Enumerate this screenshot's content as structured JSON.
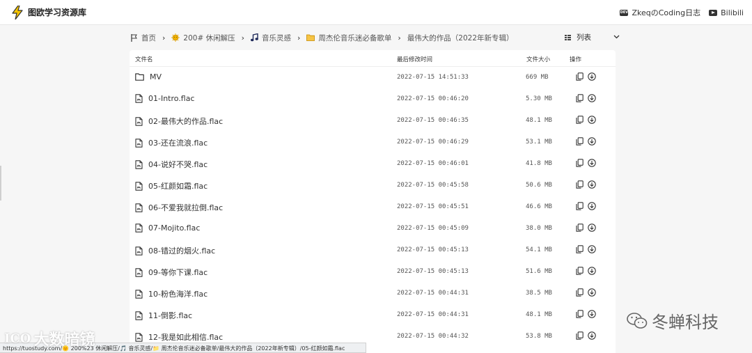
{
  "header": {
    "title": "图欧学习资源库",
    "links": [
      {
        "icon": "dev-icon",
        "badge": "DEV",
        "label": "ZkeqのCoding日志"
      },
      {
        "icon": "youtube-icon",
        "label": "Bilibili"
      }
    ]
  },
  "breadcrumb": {
    "items": [
      {
        "label": "首页",
        "icon": "home-flag-icon"
      },
      {
        "label": "200# 休闲解压",
        "icon": "sun-face-icon"
      },
      {
        "label": "音乐灵感",
        "icon": "music-note-icon"
      },
      {
        "label": "周杰伦音乐迷必备歌单",
        "icon": "folder-icon"
      },
      {
        "label": "最伟大的作品（2022年新专辑）",
        "icon": ""
      }
    ]
  },
  "view": {
    "label": "列表"
  },
  "table": {
    "headers": {
      "name": "文件名",
      "modified": "最后修改时间",
      "size": "文件大小",
      "actions": "操作"
    },
    "rows": [
      {
        "type": "folder",
        "name": "MV",
        "modified": "2022-07-15 14:51:33",
        "size": "669 MB"
      },
      {
        "type": "file",
        "name": "01-Intro.flac",
        "modified": "2022-07-15 00:46:20",
        "size": "5.30 MB"
      },
      {
        "type": "file",
        "name": "02-最伟大的作品.flac",
        "modified": "2022-07-15 00:46:35",
        "size": "48.1 MB"
      },
      {
        "type": "file",
        "name": "03-还在流浪.flac",
        "modified": "2022-07-15 00:46:29",
        "size": "53.1 MB"
      },
      {
        "type": "file",
        "name": "04-说好不哭.flac",
        "modified": "2022-07-15 00:46:01",
        "size": "41.8 MB"
      },
      {
        "type": "file",
        "name": "05-红颜如霜.flac",
        "modified": "2022-07-15 00:45:58",
        "size": "50.6 MB"
      },
      {
        "type": "file",
        "name": "06-不爱我就拉倒.flac",
        "modified": "2022-07-15 00:45:51",
        "size": "46.6 MB"
      },
      {
        "type": "file",
        "name": "07-Mojito.flac",
        "modified": "2022-07-15 00:45:09",
        "size": "38.0 MB"
      },
      {
        "type": "file",
        "name": "08-错过的烟火.flac",
        "modified": "2022-07-15 00:45:13",
        "size": "54.1 MB"
      },
      {
        "type": "file",
        "name": "09-等你下课.flac",
        "modified": "2022-07-15 00:45:13",
        "size": "51.6 MB"
      },
      {
        "type": "file",
        "name": "10-粉色海洋.flac",
        "modified": "2022-07-15 00:44:31",
        "size": "38.5 MB"
      },
      {
        "type": "file",
        "name": "11-倒影.flac",
        "modified": "2022-07-15 00:44:31",
        "size": "48.1 MB"
      },
      {
        "type": "file",
        "name": "12-我是如此相信.flac",
        "modified": "2022-07-15 00:44:32",
        "size": "53.8 MB"
      }
    ]
  },
  "status_url": "https://tuostudy.com/🌞 200%23 休闲解压/🎵 音乐灵感/📁 周杰伦音乐迷必备歌单/最伟大的作品（2022年新专辑）/05-红颜如霜.flac",
  "watermarks": {
    "left": "大数暗镜",
    "left_logo": "ICO",
    "right": "冬蝉科技"
  },
  "colors": {
    "bolt": "#f5c400",
    "sun": "#f2b200",
    "folder": "#e8a000",
    "text": "#333333"
  }
}
